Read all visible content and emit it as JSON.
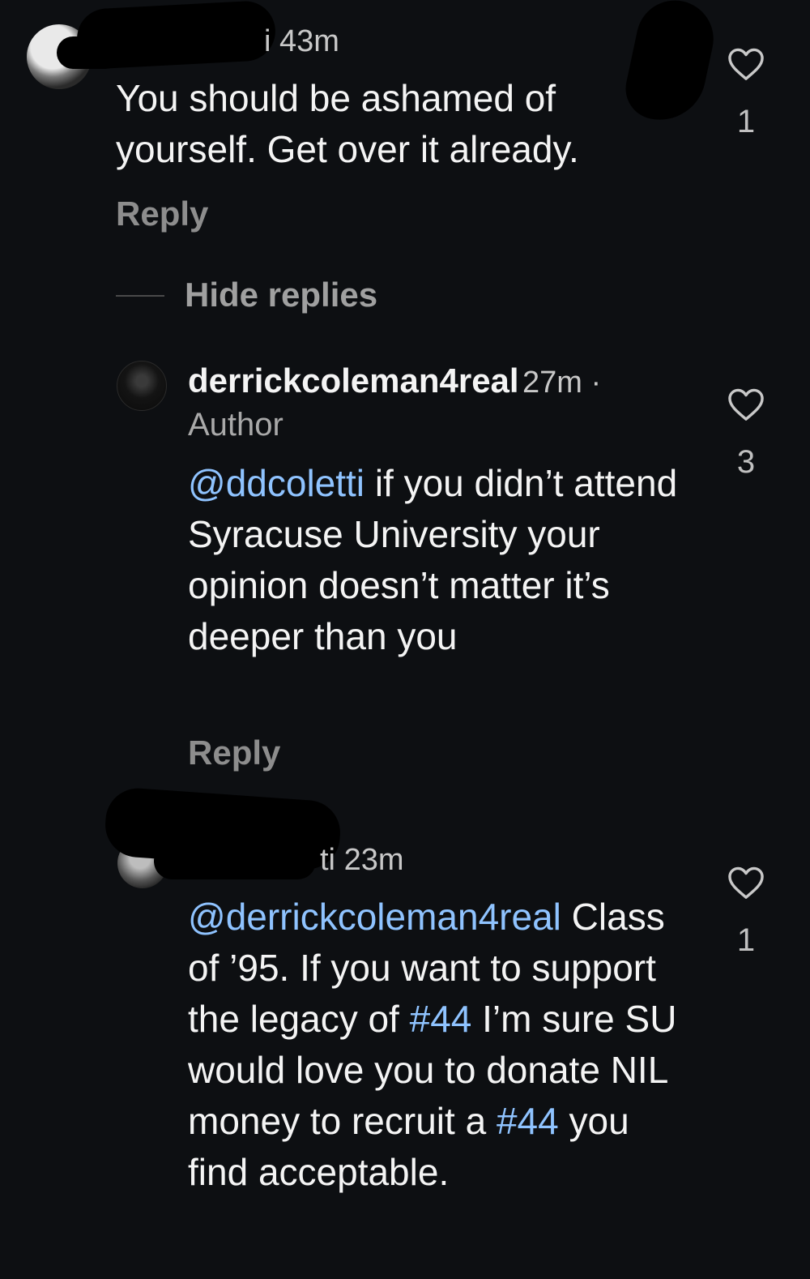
{
  "comments": [
    {
      "time": "43m",
      "username_tail": "i",
      "text": "You should be ashamed of yourself. Get over it already.",
      "reply_label": "Reply",
      "likes": "1"
    }
  ],
  "thread": {
    "hide_replies_label": "Hide replies",
    "replies": [
      {
        "username": "derrickcoleman4real",
        "time": "27m ·",
        "badge": "Author",
        "mention": "@ddcoletti",
        "text": "if you didn’t attend Syracuse University your opinion doesn’t matter it’s deeper than you",
        "reply_label": "Reply",
        "likes": "3"
      },
      {
        "username_tail": "ti",
        "time": "23m",
        "mention": "@derrickcoleman4real",
        "text_1": "Class of ’95. If you want to support the legacy of",
        "hashtag_1": "#44",
        "text_2": "I’m sure SU would love you to donate NIL money to recruit a",
        "hashtag_2": "#44",
        "text_3": "you find acceptable.",
        "likes": "1"
      }
    ]
  },
  "colors": {
    "background": "#0d0f12",
    "link": "#8fc3ff",
    "muted": "#8d8d8d"
  },
  "icons": [
    "heart-icon",
    "avatar"
  ]
}
